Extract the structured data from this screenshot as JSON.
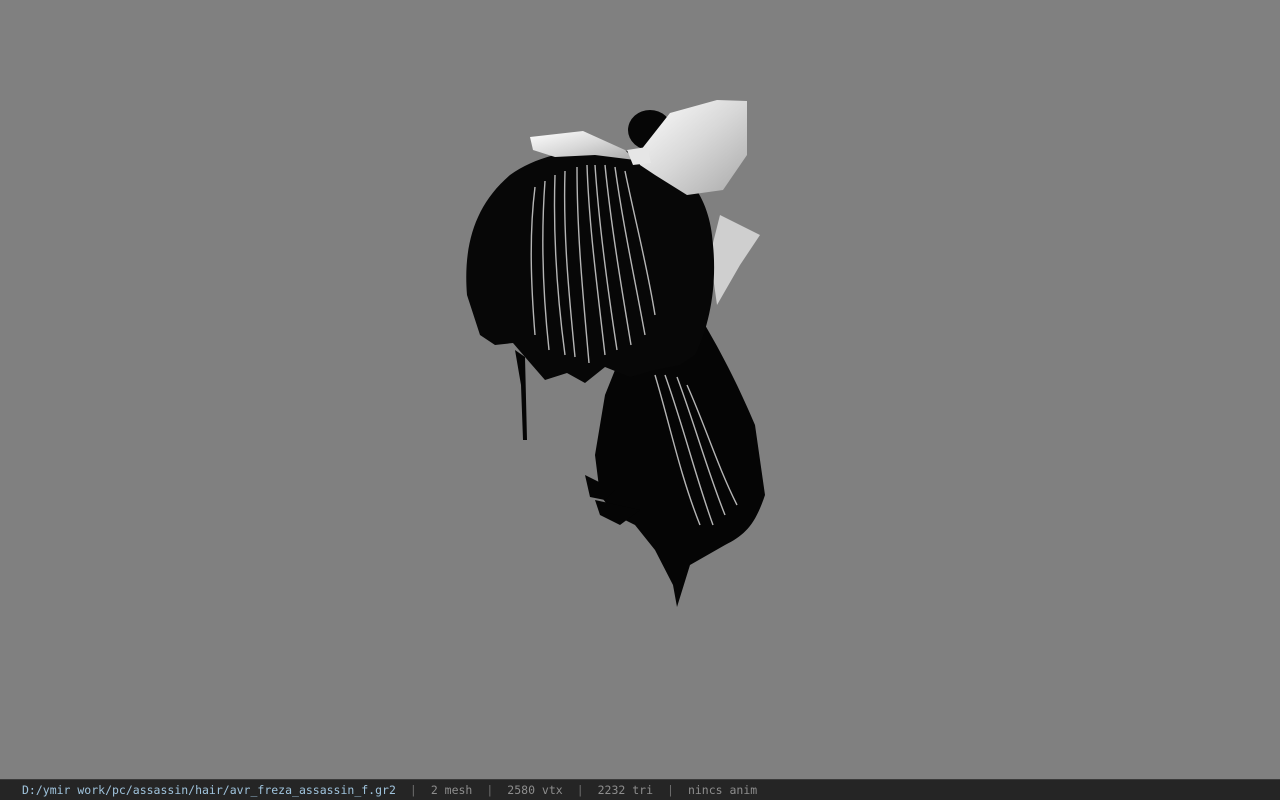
{
  "viewport": {
    "background_color": "#808080",
    "model_name": "hair model with white ribbon bow"
  },
  "statusbar": {
    "file_path": "D:/ymir work/pc/assassin/hair/avr_freza_assassin_f.gr2",
    "mesh_count": "2 mesh",
    "vertex_count": "2580 vtx",
    "triangle_count": "2232 tri",
    "anim_status": "nincs anim",
    "separator": "|",
    "path_color": "#9fc3dc",
    "text_color": "#8d8d8d"
  }
}
